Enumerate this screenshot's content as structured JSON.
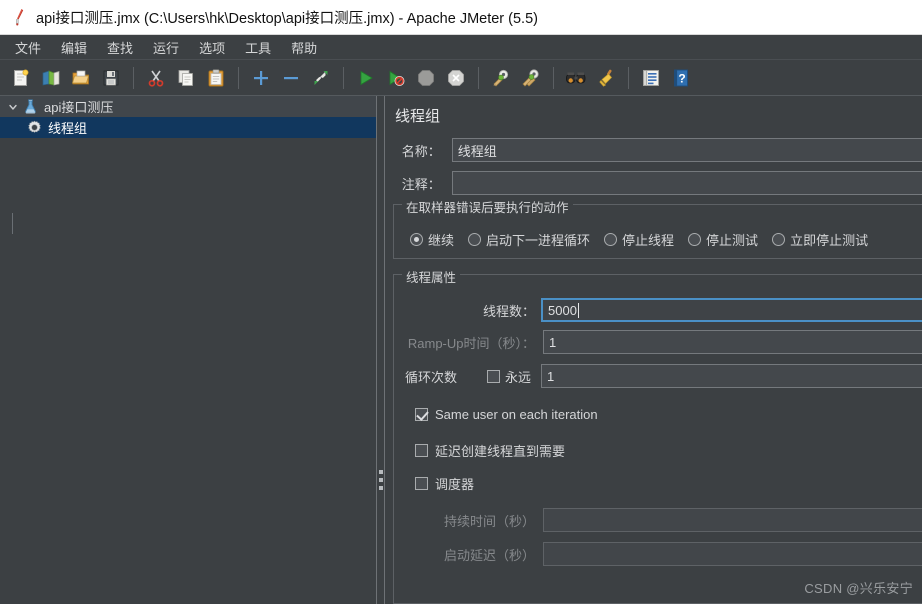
{
  "window": {
    "title": "api接口测压.jmx (C:\\Users\\hk\\Desktop\\api接口测压.jmx) - Apache JMeter (5.5)",
    "app_icon": "jmeter-feather-icon"
  },
  "menubar": {
    "items": [
      {
        "label": "文件",
        "name": "menu-file"
      },
      {
        "label": "编辑",
        "name": "menu-edit"
      },
      {
        "label": "查找",
        "name": "menu-search"
      },
      {
        "label": "运行",
        "name": "menu-run"
      },
      {
        "label": "选项",
        "name": "menu-options"
      },
      {
        "label": "工具",
        "name": "menu-tools"
      },
      {
        "label": "帮助",
        "name": "menu-help"
      }
    ]
  },
  "toolbar": {
    "groups": [
      [
        "new-icon",
        "templates-icon",
        "open-icon",
        "save-icon"
      ],
      [
        "cut-icon",
        "copy-icon",
        "paste-icon"
      ],
      [
        "expand-icon",
        "collapse-icon",
        "toggle-icon"
      ],
      [
        "start-icon",
        "start-no-timers-icon",
        "stop-icon",
        "shutdown-icon"
      ],
      [
        "clear-icon",
        "clear-all-icon"
      ],
      [
        "search-icon",
        "search-reset-icon"
      ],
      [
        "function-helper-icon",
        "help-icon"
      ]
    ]
  },
  "tree": {
    "nodes": [
      {
        "label": "api接口测压",
        "icon": "test-plan-flask-icon",
        "expanded": true,
        "selected": false
      },
      {
        "label": "线程组",
        "icon": "thread-group-gear-icon",
        "expanded": false,
        "selected": true
      }
    ]
  },
  "detail": {
    "title": "线程组",
    "name_label": "名称：",
    "name_value": "线程组",
    "comment_label": "注释：",
    "comment_value": "",
    "error_action": {
      "group_title": "在取样器错误后要执行的动作",
      "options": [
        {
          "label": "继续",
          "selected": true
        },
        {
          "label": "启动下一进程循环",
          "selected": false
        },
        {
          "label": "停止线程",
          "selected": false
        },
        {
          "label": "停止测试",
          "selected": false
        },
        {
          "label": "立即停止测试",
          "selected": false
        }
      ]
    },
    "thread_props": {
      "group_title": "线程属性",
      "threads_label": "线程数：",
      "threads_value": "5000",
      "rampup_label": "Ramp-Up时间（秒）：",
      "rampup_value": "1",
      "loops_label": "循环次数",
      "forever_label": "永远",
      "forever_checked": false,
      "loops_value": "1",
      "same_user_label": "Same user on each iteration",
      "same_user_checked": true,
      "delayed_start_label": "延迟创建线程直到需要",
      "delayed_start_checked": false,
      "scheduler_label": "调度器",
      "scheduler_checked": false,
      "duration_label": "持续时间（秒）",
      "duration_value": "",
      "startup_delay_label": "启动延迟（秒）",
      "startup_delay_value": ""
    }
  },
  "watermark": "CSDN @兴乐安宁",
  "colors": {
    "window_bg": "#3c4043",
    "titlebar_bg": "#ffffff",
    "selection_blue": "#11375e",
    "focus_blue": "#4a90c6",
    "text": "#d5d6d8"
  }
}
